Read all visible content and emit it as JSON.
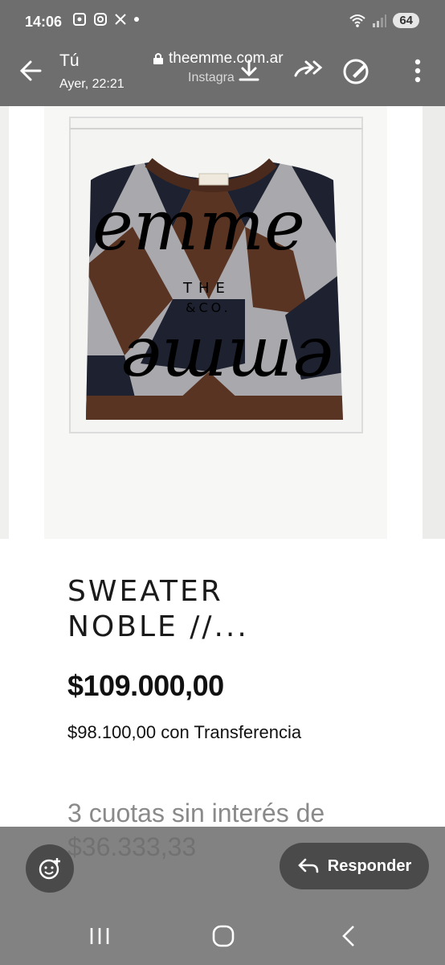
{
  "status_bar": {
    "time": "14:06",
    "notification_icons": [
      "gallery-icon",
      "instagram-icon",
      "x-icon",
      "dot-icon"
    ],
    "battery": "64"
  },
  "viewer": {
    "sender": "Tú",
    "timestamp": "Ayer, 22:21",
    "url": "theemme.com.ar",
    "source_hint": "Instagra"
  },
  "product": {
    "image_label": "sweater-in-bag",
    "title_line1": "SWEATER",
    "title_line2": "NOBLE //...",
    "price": "$109.000,00",
    "transfer_price": "$98.100,00 con Transferencia",
    "installments": "3 cuotas sin interés de $36.333,33"
  },
  "bottom": {
    "reply_label": "Responder"
  },
  "colors": {
    "overlay": "#6e6e6e",
    "button_dark": "#4a4a4a",
    "sweater_brown": "#5a3423",
    "sweater_grey": "#a9a9ad",
    "sweater_navy": "#1e2230"
  }
}
